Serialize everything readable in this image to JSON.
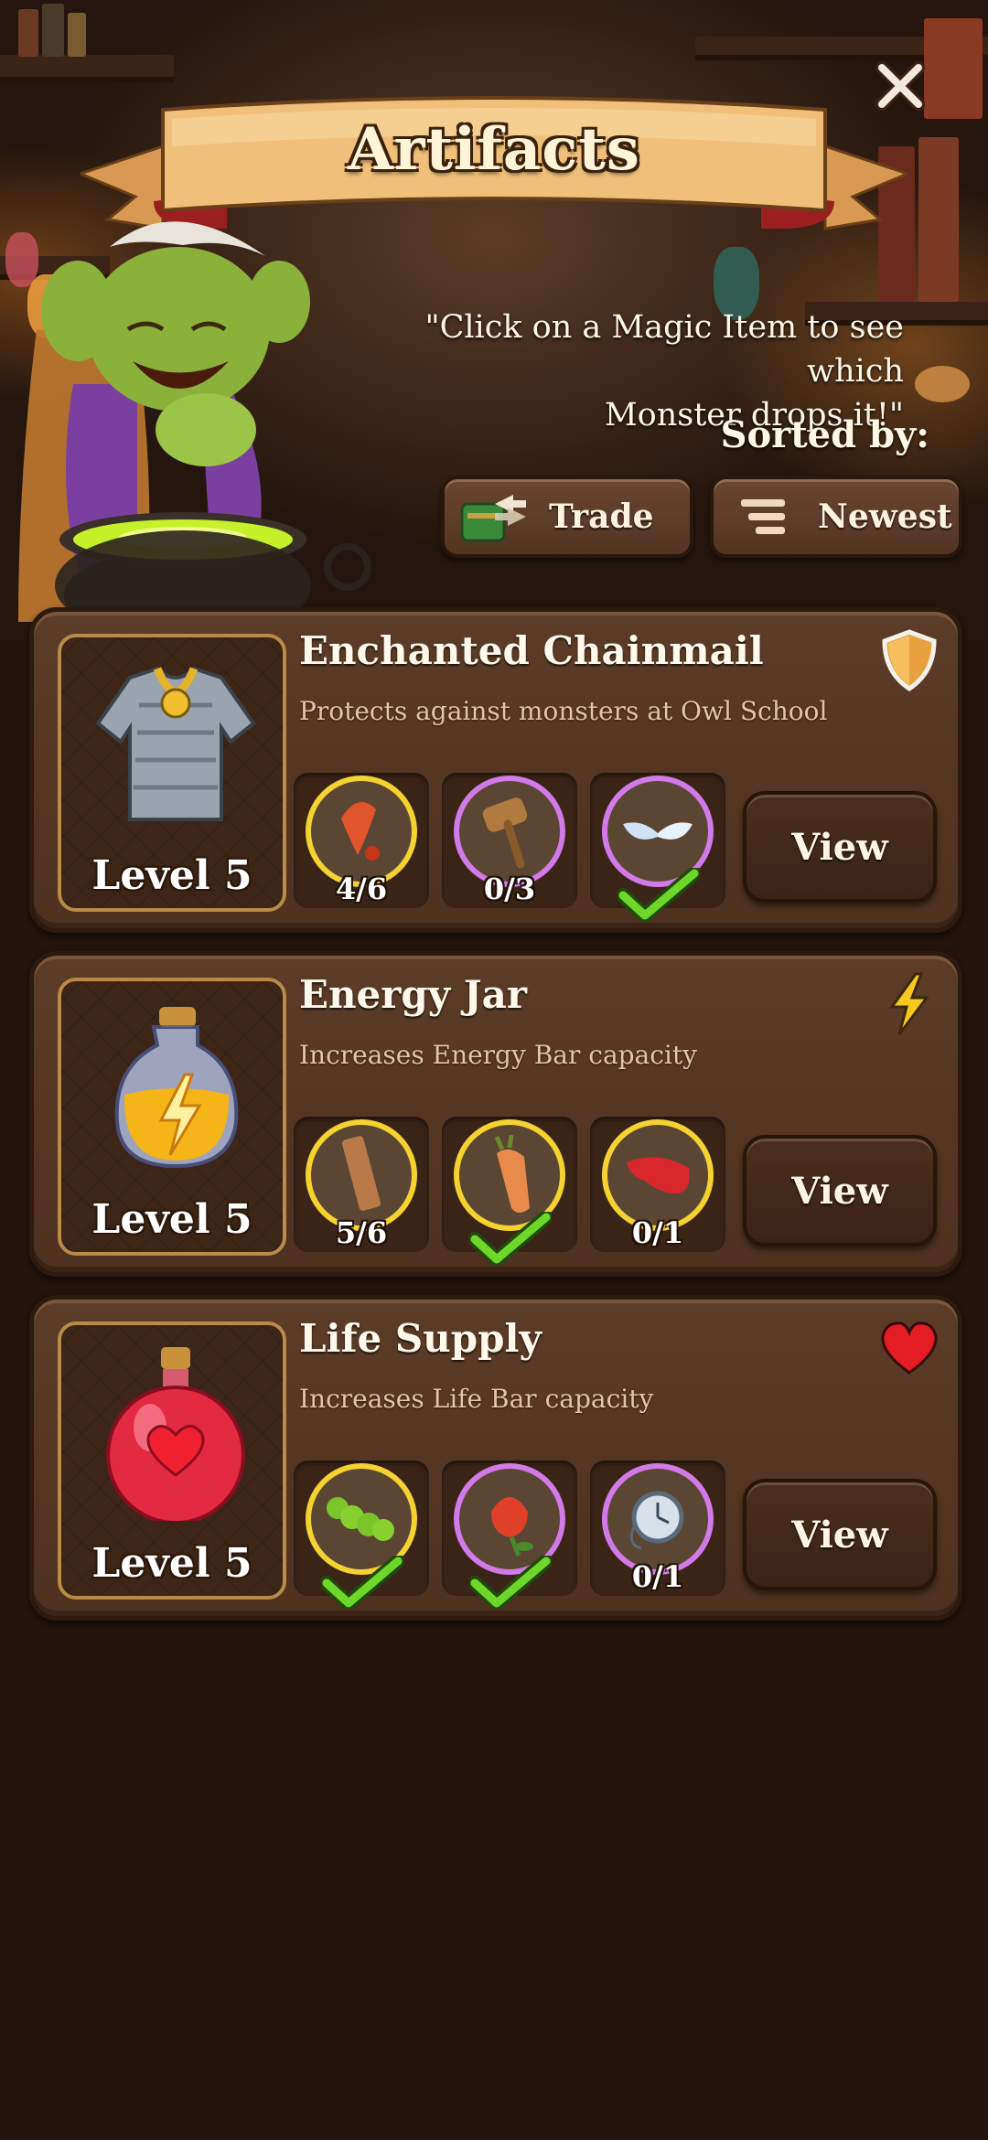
{
  "header": {
    "title": "Artifacts"
  },
  "hint": {
    "line1": "\"Click on a Magic Item to see which",
    "line2": "Monster drops it!\""
  },
  "sort": {
    "label": "Sorted by:",
    "buttons": [
      {
        "label": "Trade",
        "icon": "trade-icon"
      },
      {
        "label": "Newest",
        "icon": "sort-list-icon"
      }
    ]
  },
  "artifacts": [
    {
      "title": "Enchanted Chainmail",
      "description": "Protects against monsters at Owl School",
      "level": "Level 5",
      "type_icon": "shield-icon",
      "view_label": "View",
      "items": [
        {
          "icon": "red-feather-icon",
          "count": "4/6",
          "done": false,
          "glow": "#f5d230"
        },
        {
          "icon": "wooden-mallet-icon",
          "count": "0/3",
          "done": false,
          "glow": "#d27ae8"
        },
        {
          "icon": "wings-icon",
          "count": "",
          "done": true,
          "glow": "#d27ae8"
        }
      ]
    },
    {
      "title": "Energy Jar",
      "description": "Increases Energy Bar capacity",
      "level": "Level 5",
      "type_icon": "lightning-icon",
      "view_label": "View",
      "items": [
        {
          "icon": "wood-plank-icon",
          "count": "5/6",
          "done": false,
          "glow": "#f5d230"
        },
        {
          "icon": "carrot-icon",
          "count": "",
          "done": true,
          "glow": "#f5d230"
        },
        {
          "icon": "tongue-icon",
          "count": "0/1",
          "done": false,
          "glow": "#f5d230"
        }
      ]
    },
    {
      "title": "Life Supply",
      "description": "Increases Life Bar capacity",
      "level": "Level 5",
      "type_icon": "heart-icon",
      "view_label": "View",
      "items": [
        {
          "icon": "caterpillar-icon",
          "count": "",
          "done": true,
          "glow": "#f5d230"
        },
        {
          "icon": "rose-icon",
          "count": "",
          "done": true,
          "glow": "#d27ae8"
        },
        {
          "icon": "pocket-watch-icon",
          "count": "0/1",
          "done": false,
          "glow": "#d27ae8"
        }
      ]
    }
  ]
}
